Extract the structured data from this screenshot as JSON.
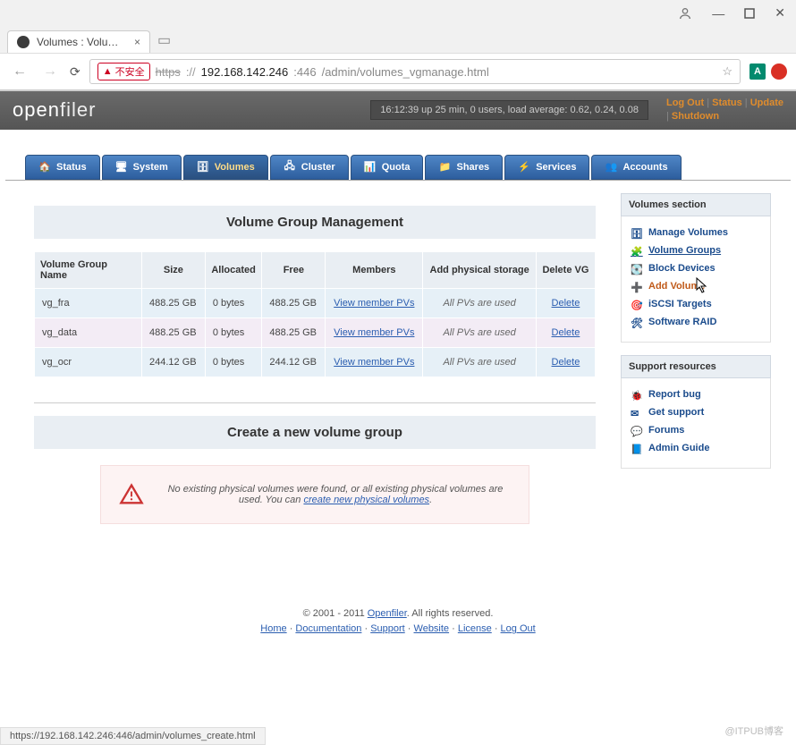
{
  "browser": {
    "tab_title": "Volumes : Volume Gro...",
    "insecure_label": "不安全",
    "url_scheme": "https",
    "url_host": "192.168.142.246",
    "url_port": ":446",
    "url_path": "/admin/volumes_vgmanage.html",
    "status_url": "https://192.168.142.246:446/admin/volumes_create.html"
  },
  "header": {
    "logo_a": "open",
    "logo_b": "filer",
    "uptime": "16:12:39 up 25 min,  0 users,  load average: 0.62, 0.24, 0.08",
    "links": {
      "logout": "Log Out",
      "status": "Status",
      "update": "Update",
      "shutdown": "Shutdown"
    }
  },
  "nav": {
    "status": "Status",
    "system": "System",
    "volumes": "Volumes",
    "cluster": "Cluster",
    "quota": "Quota",
    "shares": "Shares",
    "services": "Services",
    "accounts": "Accounts"
  },
  "vg_panel": {
    "title": "Volume Group Management",
    "cols": {
      "name": "Volume Group Name",
      "size": "Size",
      "alloc": "Allocated",
      "free": "Free",
      "members": "Members",
      "addpv": "Add physical storage",
      "del": "Delete VG"
    },
    "rows": [
      {
        "name": "vg_fra",
        "size": "488.25 GB",
        "alloc": "0 bytes",
        "free": "488.25 GB",
        "members": "View member PVs",
        "addpv": "All PVs are used",
        "del": "Delete"
      },
      {
        "name": "vg_data",
        "size": "488.25 GB",
        "alloc": "0 bytes",
        "free": "488.25 GB",
        "members": "View member PVs",
        "addpv": "All PVs are used",
        "del": "Delete"
      },
      {
        "name": "vg_ocr",
        "size": "244.12 GB",
        "alloc": "0 bytes",
        "free": "244.12 GB",
        "members": "View member PVs",
        "addpv": "All PVs are used",
        "del": "Delete"
      }
    ]
  },
  "create_panel": {
    "title": "Create a new volume group",
    "msg_a": "No existing physical volumes were found, or all existing physical volumes are used. You can ",
    "msg_link": "create new physical volumes",
    "msg_b": "."
  },
  "sidebar": {
    "volumes_title": "Volumes section",
    "volumes_items": [
      {
        "label": "Manage Volumes",
        "state": ""
      },
      {
        "label": "Volume Groups",
        "state": "current"
      },
      {
        "label": "Block Devices",
        "state": ""
      },
      {
        "label": "Add Volume",
        "state": "active"
      },
      {
        "label": "iSCSI Targets",
        "state": ""
      },
      {
        "label": "Software RAID",
        "state": ""
      }
    ],
    "support_title": "Support resources",
    "support_items": [
      {
        "label": "Report bug"
      },
      {
        "label": "Get support"
      },
      {
        "label": "Forums"
      },
      {
        "label": "Admin Guide"
      }
    ]
  },
  "footer": {
    "copy_a": "© 2001 - 2011 ",
    "copy_link": "Openfiler",
    "copy_b": ". All rights reserved.",
    "links": {
      "home": "Home",
      "docs": "Documentation",
      "support": "Support",
      "website": "Website",
      "license": "License",
      "logout": "Log Out"
    }
  },
  "watermark": "@ITPUB博客"
}
